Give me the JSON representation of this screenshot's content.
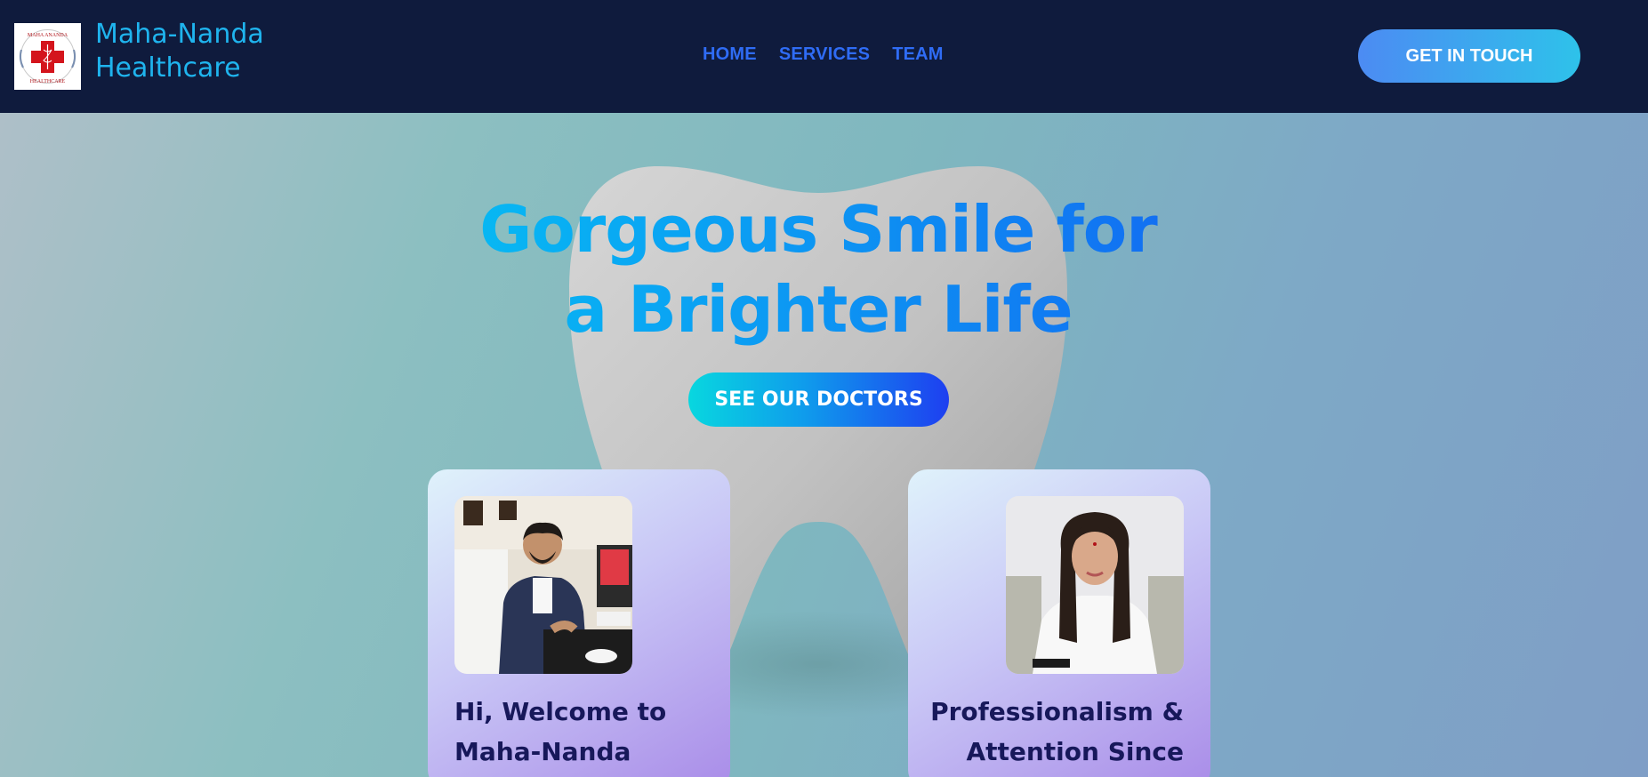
{
  "header": {
    "logo": {
      "text_top": "MAHA ANANDA",
      "text_bottom": "HEALTHCARE",
      "accent_color": "#d4141c"
    },
    "brand_line1": "Maha-Nanda",
    "brand_line2": "Healthcare",
    "nav": [
      "HOME",
      "SERVICES",
      "TEAM"
    ],
    "cta_label": "GET IN TOUCH"
  },
  "hero": {
    "headline": {
      "line1": "Gorgeous Smile for",
      "line2": "a Brighter Life"
    },
    "button_label": "SEE OUR DOCTORS",
    "cards": [
      {
        "photo": "doctor-man-at-desk-photo",
        "text_line1": "Hi, Welcome to",
        "text_line2": "Maha-Nanda"
      },
      {
        "photo": "doctor-woman-in-white-coat-photo",
        "text_line1": "Professionalism &",
        "text_line2": "Attention Since"
      }
    ]
  },
  "colors": {
    "header_bg": "#0f1b3d",
    "brand": "#1fb4ee",
    "nav": "#2f6cf5",
    "headline_gradient": [
      "#00e6f2",
      "#1a3cf0"
    ]
  }
}
